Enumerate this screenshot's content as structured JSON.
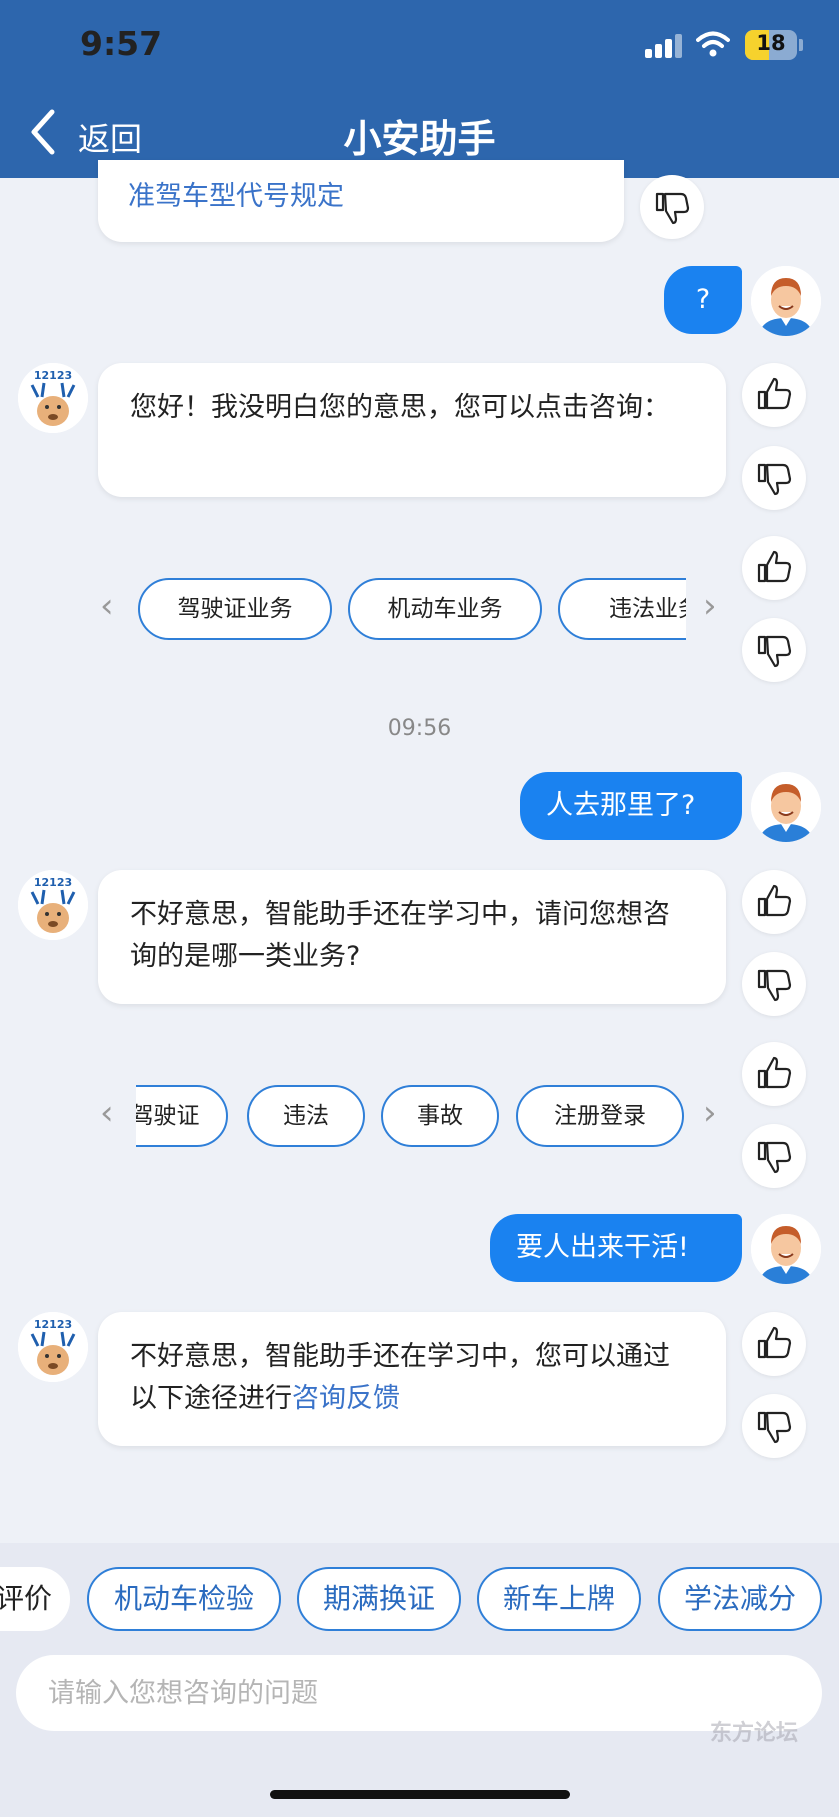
{
  "status_bar": {
    "time": "9:57",
    "battery": "18"
  },
  "nav": {
    "back_label": "返回",
    "title": "小安助手"
  },
  "messages": {
    "m0_text": "准驾车型代号规定",
    "m1_text": "?",
    "m2_text": "您好！我没明白您的意思，您可以点击咨询：",
    "m2_chips": [
      "驾驶证业务",
      "机动车业务",
      "违法业务"
    ],
    "timestamp": "09:56",
    "m3_text": "人去那里了?",
    "m4_text": "不好意思，智能助手还在学习中，请问您想咨询的是哪一类业务?",
    "m4_chips": [
      "驾驶证",
      "违法",
      "事故",
      "注册登录"
    ],
    "m5_text": "要人出来干活!",
    "m6_text_prefix": "不好意思，智能助手还在学习中，您可以通过以下途径进行",
    "m6_link": "咨询反馈"
  },
  "quick_chips": [
    "评价",
    "机动车检验",
    "期满换证",
    "新车上牌",
    "学法减分"
  ],
  "input": {
    "placeholder": "请输入您想咨询的问题"
  },
  "watermark": "东方论坛",
  "colors": {
    "header": "#2d66ad",
    "user_bubble": "#1a82f0",
    "accent": "#2f7fd8"
  }
}
